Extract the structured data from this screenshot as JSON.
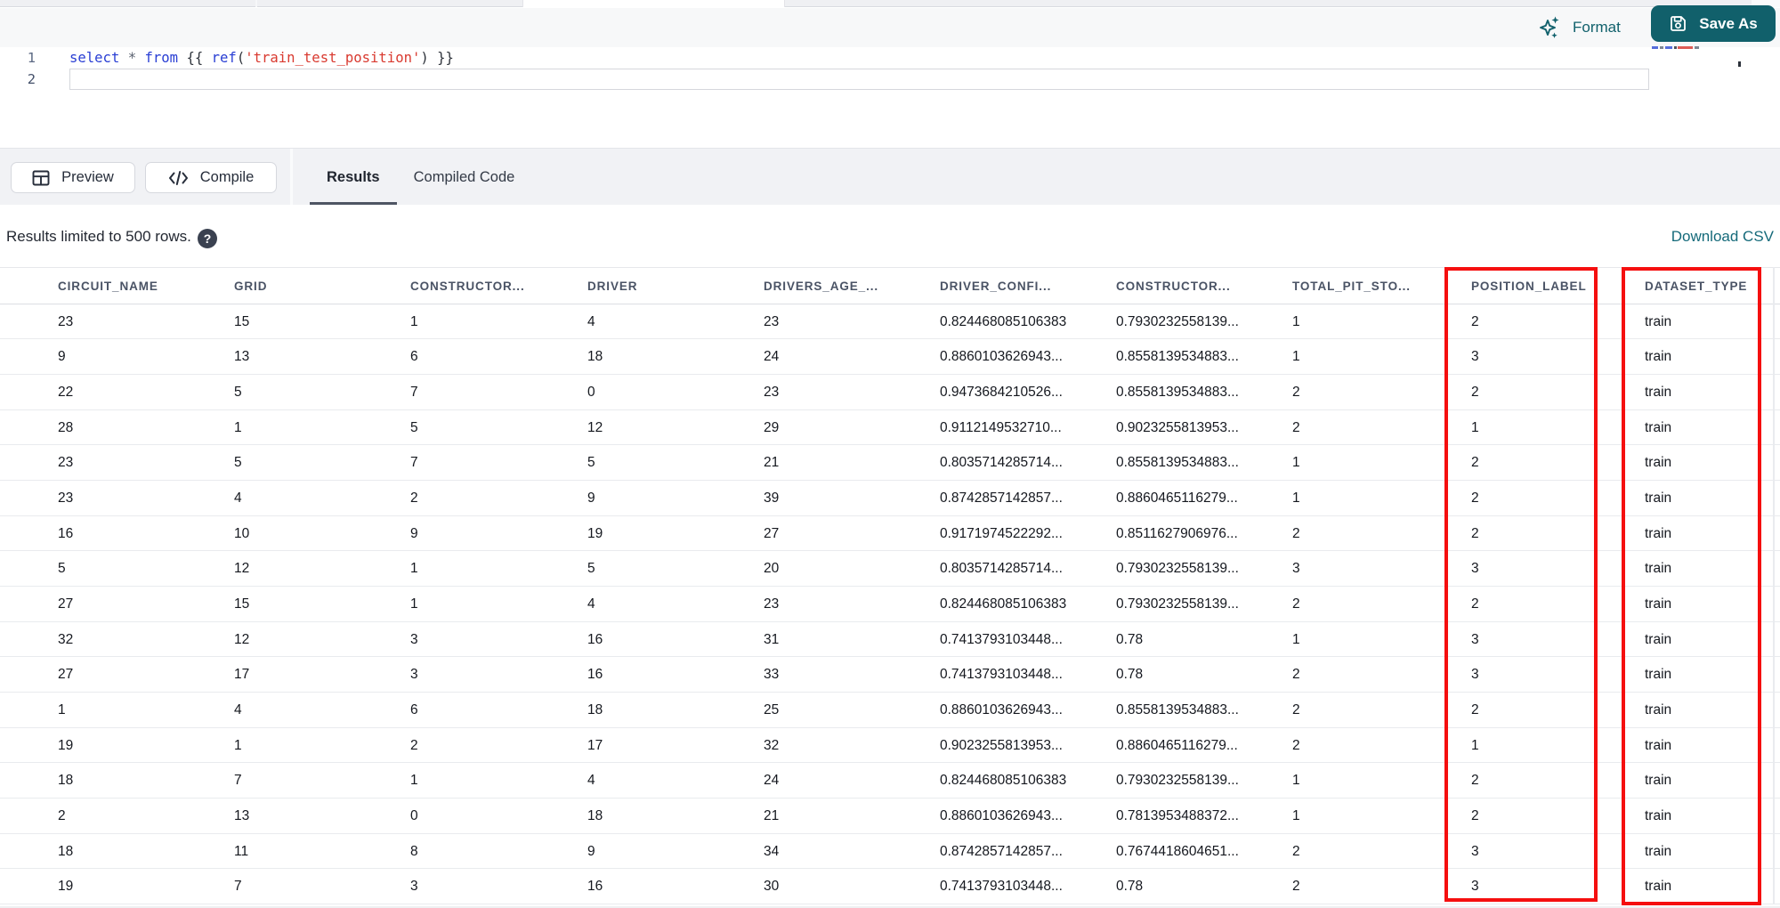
{
  "editor_toolbar": {
    "format_label": "Format",
    "save_as_label": "Save As",
    "accent_teal": "#11616c"
  },
  "editor": {
    "line_numbers": [
      "1",
      "2"
    ],
    "code_text": "select * from {{ ref('train_test_position') }}",
    "code_tokens": [
      {
        "text": "select",
        "type": "kw"
      },
      {
        "text": " ",
        "type": "pl"
      },
      {
        "text": "*",
        "type": "op"
      },
      {
        "text": " ",
        "type": "pl"
      },
      {
        "text": "from",
        "type": "kw"
      },
      {
        "text": " ",
        "type": "pl"
      },
      {
        "text": "{{ ",
        "type": "br"
      },
      {
        "text": "ref",
        "type": "fn"
      },
      {
        "text": "(",
        "type": "br"
      },
      {
        "text": "'train_test_position'",
        "type": "str"
      },
      {
        "text": ")",
        "type": "br"
      },
      {
        "text": " }}",
        "type": "br"
      }
    ],
    "minimap_marks": [
      {
        "x": 0,
        "w": 7,
        "color": "#3a55d6"
      },
      {
        "x": 9,
        "w": 4,
        "color": "#6a7280"
      },
      {
        "x": 15,
        "w": 8,
        "color": "#3a55d6"
      },
      {
        "x": 25,
        "w": 3,
        "color": "#30363f"
      },
      {
        "x": 29,
        "w": 17,
        "color": "#d84038"
      },
      {
        "x": 48,
        "w": 5,
        "color": "#6a7280"
      }
    ]
  },
  "results_panel": {
    "preview_label": "Preview",
    "compile_label": "Compile",
    "tabs": [
      {
        "label": "Results",
        "active": true
      },
      {
        "label": "Compiled Code",
        "active": false
      }
    ],
    "limit_note": "Results limited to 500 rows.",
    "help_glyph": "?",
    "download_csv_label": "Download CSV"
  },
  "table": {
    "columns": [
      "CIRCUIT_NAME",
      "GRID",
      "CONSTRUCTOR...",
      "DRIVER",
      "DRIVERS_AGE_...",
      "DRIVER_CONFI...",
      "CONSTRUCTOR...",
      "TOTAL_PIT_STO...",
      "POSITION_LABEL",
      "DATASET_TYPE"
    ],
    "rows": [
      [
        "23",
        "15",
        "1",
        "4",
        "23",
        "0.824468085106383",
        "0.7930232558139...",
        "1",
        "2",
        "train"
      ],
      [
        "9",
        "13",
        "6",
        "18",
        "24",
        "0.8860103626943...",
        "0.8558139534883...",
        "1",
        "3",
        "train"
      ],
      [
        "22",
        "5",
        "7",
        "0",
        "23",
        "0.9473684210526...",
        "0.8558139534883...",
        "2",
        "2",
        "train"
      ],
      [
        "28",
        "1",
        "5",
        "12",
        "29",
        "0.9112149532710...",
        "0.9023255813953...",
        "2",
        "1",
        "train"
      ],
      [
        "23",
        "5",
        "7",
        "5",
        "21",
        "0.8035714285714...",
        "0.8558139534883...",
        "1",
        "2",
        "train"
      ],
      [
        "23",
        "4",
        "2",
        "9",
        "39",
        "0.8742857142857...",
        "0.8860465116279...",
        "1",
        "2",
        "train"
      ],
      [
        "16",
        "10",
        "9",
        "19",
        "27",
        "0.9171974522292...",
        "0.8511627906976...",
        "2",
        "2",
        "train"
      ],
      [
        "5",
        "12",
        "1",
        "5",
        "20",
        "0.8035714285714...",
        "0.7930232558139...",
        "3",
        "3",
        "train"
      ],
      [
        "27",
        "15",
        "1",
        "4",
        "23",
        "0.824468085106383",
        "0.7930232558139...",
        "2",
        "2",
        "train"
      ],
      [
        "32",
        "12",
        "3",
        "16",
        "31",
        "0.7413793103448...",
        "0.78",
        "1",
        "3",
        "train"
      ],
      [
        "27",
        "17",
        "3",
        "16",
        "33",
        "0.7413793103448...",
        "0.78",
        "2",
        "3",
        "train"
      ],
      [
        "1",
        "4",
        "6",
        "18",
        "25",
        "0.8860103626943...",
        "0.8558139534883...",
        "2",
        "2",
        "train"
      ],
      [
        "19",
        "1",
        "2",
        "17",
        "32",
        "0.9023255813953...",
        "0.8860465116279...",
        "2",
        "1",
        "train"
      ],
      [
        "18",
        "7",
        "1",
        "4",
        "24",
        "0.824468085106383",
        "0.7930232558139...",
        "1",
        "2",
        "train"
      ],
      [
        "2",
        "13",
        "0",
        "18",
        "21",
        "0.8860103626943...",
        "0.7813953488372...",
        "1",
        "2",
        "train"
      ],
      [
        "18",
        "11",
        "8",
        "9",
        "34",
        "0.8742857142857...",
        "0.7674418604651...",
        "2",
        "3",
        "train"
      ],
      [
        "19",
        "7",
        "3",
        "16",
        "30",
        "0.7413793103448...",
        "0.78",
        "2",
        "3",
        "train"
      ]
    ]
  },
  "annotations": {
    "highlight_color": "#f50f0f",
    "boxes": [
      "POSITION_LABEL column",
      "DATASET_TYPE column"
    ]
  }
}
